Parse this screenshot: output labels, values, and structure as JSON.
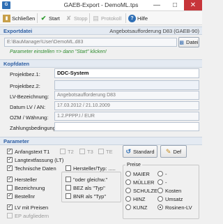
{
  "window": {
    "title": "GAEB-Export - DemoML.tps"
  },
  "toolbar": {
    "close_label": "Schließen",
    "start_label": "Start",
    "stop_label": "Stopp",
    "protocol_label": "Protokoll",
    "help_label": "Hilfe"
  },
  "export": {
    "section_title": "Exportdatei",
    "format_label": "Angebotsaufforderung D83 (GAEB-90)",
    "file_value": "E:\\BauManager\\User\\DemoML.d83",
    "file_button": "Datei",
    "hint": "Parameter einstellen => dann \"Start\" klicken!"
  },
  "header": {
    "section_title": "Kopfdaten",
    "fields": [
      {
        "label": "Projektbez.1:",
        "value": "DDC-System"
      },
      {
        "label": "Projektbez.2:",
        "value": ""
      },
      {
        "label": "LV-Bezeichnung:",
        "value": "Angebotsaufforderung D83"
      },
      {
        "label": "Datum LV / AN:",
        "value": "17.03.2012 / 21.10.2009"
      },
      {
        "label": "OZM / Währung:",
        "value": "1.2.PPPP.I / EUR"
      },
      {
        "label": "Zahlungsbedingung:",
        "value": ""
      }
    ]
  },
  "params": {
    "section_title": "Parameter",
    "checks_left": [
      {
        "label": "Anfangstext T1",
        "checked": true,
        "enabled": true
      },
      {
        "label": "Langtextfassung (LT)",
        "checked": true,
        "enabled": true
      },
      {
        "label": "Technische Daten",
        "checked": true,
        "enabled": true
      },
      {
        "label": "Hersteller",
        "checked": true,
        "enabled": true
      },
      {
        "label": "Bezeichnung",
        "checked": false,
        "enabled": true
      },
      {
        "label": "Bestellnr",
        "checked": true,
        "enabled": true
      },
      {
        "label": "LV mit Preisen",
        "checked": true,
        "enabled": true
      },
      {
        "label": "EP aufgliedern",
        "checked": false,
        "enabled": false
      }
    ],
    "t_checks": [
      {
        "label": "T2",
        "checked": false
      },
      {
        "label": "T3",
        "checked": false
      },
      {
        "label": "TE",
        "checked": false
      }
    ],
    "hersteller_typ": "Hersteller/Typ: .....",
    "checks_mid": [
      {
        "label": "\"oder gleichw.\"",
        "checked": false
      },
      {
        "label": "BEZ als \"Typ\"",
        "checked": false
      },
      {
        "label": "BNR als \"Typ\"",
        "checked": false
      }
    ],
    "standard_button": "Standard",
    "def_button": "Def",
    "prices_title": "Preise",
    "prices": [
      {
        "label": "MAIER",
        "selected": false
      },
      {
        "label": "-",
        "selected": false
      },
      {
        "label": "MÜLLER",
        "selected": false
      },
      {
        "label": "-",
        "selected": false
      },
      {
        "label": "SCHULZE",
        "selected": false
      },
      {
        "label": "Kosten",
        "selected": false
      },
      {
        "label": "HINZ",
        "selected": false
      },
      {
        "label": "Umsatz",
        "selected": false
      },
      {
        "label": "KUNZ",
        "selected": false
      },
      {
        "label": "Rosinen-LV",
        "selected": true
      }
    ]
  },
  "colors": {
    "accent": "#2d5ea3",
    "hint": "#2d8b2d",
    "section_bg": "#e4eaf2"
  }
}
